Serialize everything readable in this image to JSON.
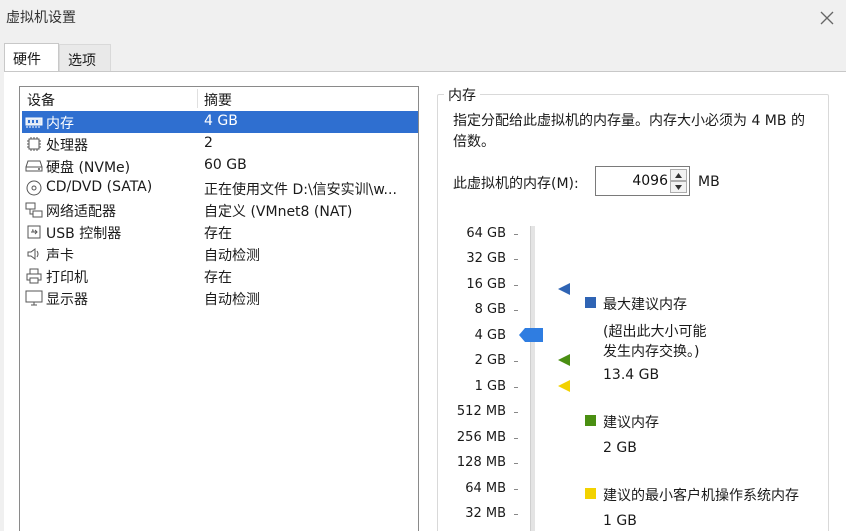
{
  "window": {
    "title": "虚拟机设置"
  },
  "tabs": [
    {
      "label": "硬件"
    },
    {
      "label": "选项"
    }
  ],
  "device_list": {
    "headers": {
      "device": "设备",
      "summary": "摘要"
    },
    "rows": [
      {
        "name": "内存",
        "summary": "4 GB",
        "icon": "memory-icon"
      },
      {
        "name": "处理器",
        "summary": "2",
        "icon": "processor-icon"
      },
      {
        "name": "硬盘 (NVMe)",
        "summary": "60 GB",
        "icon": "hard-disk-icon"
      },
      {
        "name": "CD/DVD (SATA)",
        "summary": "正在使用文件 D:\\信安实训\\w...",
        "icon": "cd-dvd-icon"
      },
      {
        "name": "网络适配器",
        "summary": "自定义 (VMnet8 (NAT)",
        "icon": "network-adapter-icon"
      },
      {
        "name": "USB 控制器",
        "summary": "存在",
        "icon": "usb-icon"
      },
      {
        "name": "声卡",
        "summary": "自动检测",
        "icon": "sound-card-icon"
      },
      {
        "name": "打印机",
        "summary": "存在",
        "icon": "printer-icon"
      },
      {
        "name": "显示器",
        "summary": "自动检测",
        "icon": "display-icon"
      }
    ]
  },
  "memory": {
    "group_title": "内存",
    "description": "指定分配给此虚拟机的内存量。内存大小必须为 4 MB 的倍数。",
    "field_label": "此虚拟机的内存(M):",
    "value": "4096",
    "unit": "MB",
    "scale_labels": [
      "64 GB",
      "32 GB",
      "16 GB",
      "8 GB",
      "4 GB",
      "2 GB",
      "1 GB",
      "512 MB",
      "256 MB",
      "128 MB",
      "64 MB",
      "32 MB"
    ],
    "current_level": "4 GB",
    "legend": {
      "max": {
        "title": "最大建议内存",
        "note_line1": "(超出此大小可能",
        "note_line2": "发生内存交换。)",
        "value": "13.4 GB",
        "color": "#2f64b4"
      },
      "recommended": {
        "title": "建议内存",
        "value": "2 GB",
        "color": "#4a8f12"
      },
      "min": {
        "title": "建议的最小客户机操作系统内存",
        "value": "1 GB",
        "color": "#f2d200"
      }
    },
    "slider_color": "#2f7de1"
  }
}
